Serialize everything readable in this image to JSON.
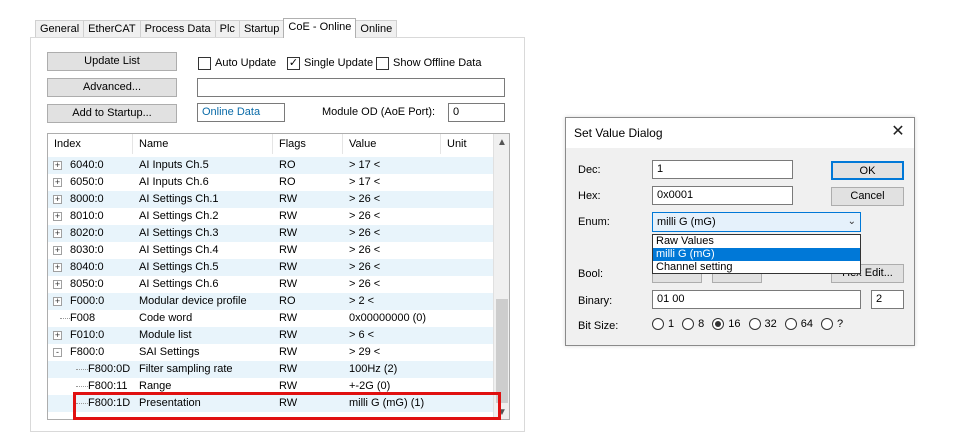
{
  "tabs": [
    "General",
    "EtherCAT",
    "Process Data",
    "Plc",
    "Startup",
    "CoE - Online",
    "Online"
  ],
  "active_tab": "CoE - Online",
  "toolbar": {
    "update_list": "Update List",
    "advanced": "Advanced...",
    "add_to_startup": "Add to Startup...",
    "auto_update": "Auto Update",
    "single_update": "Single Update",
    "show_offline": "Show Offline Data",
    "online_data": "Online Data",
    "module_od_label": "Module OD (AoE Port):",
    "module_od_value": "0"
  },
  "columns": [
    "Index",
    "Name",
    "Flags",
    "Value",
    "Unit"
  ],
  "rows": [
    {
      "index": "6040:0",
      "name": "AI Inputs Ch.5",
      "flags": "RO",
      "value": "> 17 <",
      "expander": "+"
    },
    {
      "index": "6050:0",
      "name": "AI Inputs Ch.6",
      "flags": "RO",
      "value": "> 17 <",
      "expander": "+"
    },
    {
      "index": "8000:0",
      "name": "AI Settings Ch.1",
      "flags": "RW",
      "value": "> 26 <",
      "expander": "+"
    },
    {
      "index": "8010:0",
      "name": "AI Settings Ch.2",
      "flags": "RW",
      "value": "> 26 <",
      "expander": "+"
    },
    {
      "index": "8020:0",
      "name": "AI Settings Ch.3",
      "flags": "RW",
      "value": "> 26 <",
      "expander": "+"
    },
    {
      "index": "8030:0",
      "name": "AI Settings Ch.4",
      "flags": "RW",
      "value": "> 26 <",
      "expander": "+"
    },
    {
      "index": "8040:0",
      "name": "AI Settings Ch.5",
      "flags": "RW",
      "value": "> 26 <",
      "expander": "+"
    },
    {
      "index": "8050:0",
      "name": "AI Settings Ch.6",
      "flags": "RW",
      "value": "> 26 <",
      "expander": "+"
    },
    {
      "index": "F000:0",
      "name": "Modular device profile",
      "flags": "RO",
      "value": "> 2 <",
      "expander": "+"
    },
    {
      "index": "F008",
      "name": "Code word",
      "flags": "RW",
      "value": "0x00000000 (0)",
      "expander": ""
    },
    {
      "index": "F010:0",
      "name": "Module list",
      "flags": "RW",
      "value": "> 6 <",
      "expander": "+"
    },
    {
      "index": "F800:0",
      "name": "SAI Settings",
      "flags": "RW",
      "value": "> 29 <",
      "expander": "-"
    },
    {
      "index": "F800:0D",
      "name": "Filter sampling rate",
      "flags": "RW",
      "value": "100Hz (2)",
      "expander": "",
      "child": true
    },
    {
      "index": "F800:11",
      "name": "Range",
      "flags": "RW",
      "value": "+-2G (0)",
      "expander": "",
      "child": true
    },
    {
      "index": "F800:1D",
      "name": "Presentation",
      "flags": "RW",
      "value": "milli G (mG) (1)",
      "expander": "",
      "child": true
    }
  ],
  "dialog": {
    "title": "Set Value Dialog",
    "dec_label": "Dec:",
    "dec_value": "1",
    "hex_label": "Hex:",
    "hex_value": "0x0001",
    "enum_label": "Enum:",
    "enum_value": "milli G (mG)",
    "enum_options": [
      "Raw Values",
      "milli G (mG)",
      "Channel setting"
    ],
    "enum_selected_index": 1,
    "bool_label": "Bool:",
    "binary_label": "Binary:",
    "binary_value": "01 00",
    "binary_len": "2",
    "bitsize_label": "Bit Size:",
    "bitsize_options": [
      "1",
      "8",
      "16",
      "32",
      "64",
      "?"
    ],
    "bitsize_selected": "16",
    "ok": "OK",
    "cancel": "Cancel",
    "hex_edit": "Hex Edit..."
  }
}
